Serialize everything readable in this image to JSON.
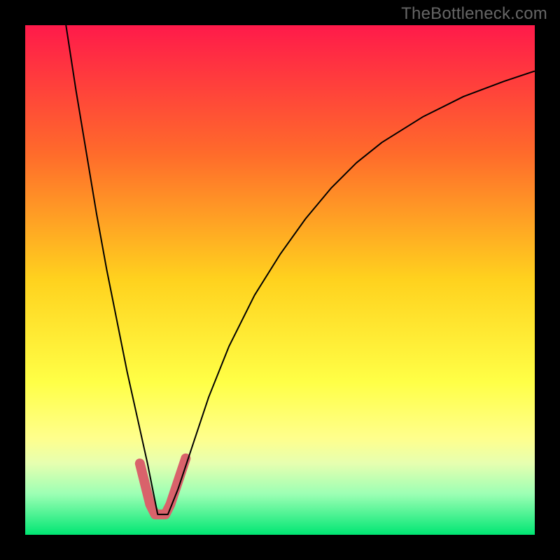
{
  "watermark": "TheBottleneck.com",
  "chart_data": {
    "type": "line",
    "title": "",
    "xlabel": "",
    "ylabel": "",
    "xlim": [
      0,
      100
    ],
    "ylim": [
      0,
      100
    ],
    "gradient_stops": [
      {
        "offset": 0,
        "color": "#ff1a4a"
      },
      {
        "offset": 25,
        "color": "#ff6a2b"
      },
      {
        "offset": 50,
        "color": "#ffd21e"
      },
      {
        "offset": 70,
        "color": "#ffff46"
      },
      {
        "offset": 81,
        "color": "#ffff8c"
      },
      {
        "offset": 86,
        "color": "#e6ffb0"
      },
      {
        "offset": 92,
        "color": "#9cffb4"
      },
      {
        "offset": 100,
        "color": "#00e673"
      }
    ],
    "series": [
      {
        "name": "bottleneck-curve",
        "color": "#000000",
        "stroke_width": 2,
        "x": [
          8,
          10,
          12,
          14,
          16,
          18,
          20,
          22,
          24,
          25,
          26,
          27,
          28,
          30,
          33,
          36,
          40,
          45,
          50,
          55,
          60,
          65,
          70,
          78,
          86,
          94,
          100
        ],
        "y": [
          100,
          87,
          75,
          63,
          52,
          42,
          32,
          23,
          14,
          9,
          4,
          4,
          4,
          9,
          18,
          27,
          37,
          47,
          55,
          62,
          68,
          73,
          77,
          82,
          86,
          89,
          91
        ]
      },
      {
        "name": "highlight-valley",
        "color": "#d9626b",
        "stroke_width": 14,
        "linecap": "round",
        "x": [
          22.5,
          23.5,
          24.5,
          25.5,
          26.5,
          27.5,
          28.5,
          29.5,
          30.5,
          31.5
        ],
        "y": [
          14,
          10,
          6,
          4,
          4,
          4,
          6,
          9,
          12,
          15
        ]
      }
    ]
  }
}
